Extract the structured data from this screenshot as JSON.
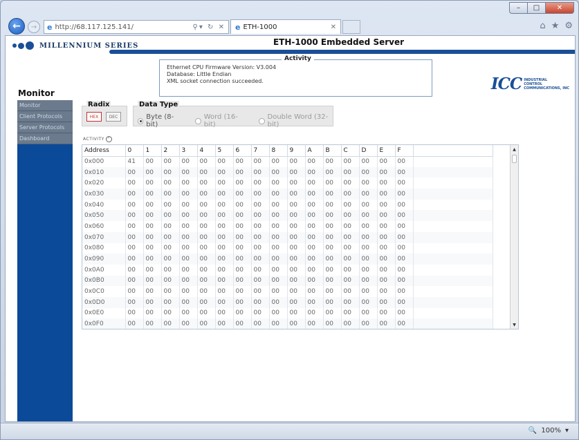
{
  "browser": {
    "url": "http://68.117.125.141/",
    "tab_title": "ETH-1000",
    "zoom": "100%"
  },
  "header": {
    "logo_text": "MILLENNIUM SERIES",
    "server_title": "ETH-1000 Embedded Server",
    "activity_title": "Activity",
    "activity_lines": [
      "Ethernet CPU Firmware Version: V3.004",
      "Database: Little Endian",
      "XML socket connection succeeded."
    ],
    "icc_mark": "ICC",
    "icc_text": [
      "INDUSTRIAL",
      "CONTROL",
      "COMMUNICATIONS, INC"
    ],
    "page_title": "Monitor"
  },
  "sidebar": {
    "items": [
      {
        "label": "Monitor"
      },
      {
        "label": "Client Protocols"
      },
      {
        "label": "Server Protocols"
      },
      {
        "label": "Dashboard"
      }
    ]
  },
  "controls": {
    "radix_title": "Radix",
    "radix_hex": "HEX",
    "radix_dec": "DEC",
    "data_type_title": "Data Type",
    "options": [
      "Byte (8-bit)",
      "Word (16-bit)",
      "Double Word (32-bit)"
    ],
    "activity_label": "ACTIVITY"
  },
  "table": {
    "headers": [
      "Address",
      "0",
      "1",
      "2",
      "3",
      "4",
      "5",
      "6",
      "7",
      "8",
      "9",
      "A",
      "B",
      "C",
      "D",
      "E",
      "F",
      ""
    ],
    "rows": [
      {
        "addr": "0x000",
        "values": [
          "41",
          "00",
          "00",
          "00",
          "00",
          "00",
          "00",
          "00",
          "00",
          "00",
          "00",
          "00",
          "00",
          "00",
          "00",
          "00"
        ]
      },
      {
        "addr": "0x010",
        "values": [
          "00",
          "00",
          "00",
          "00",
          "00",
          "00",
          "00",
          "00",
          "00",
          "00",
          "00",
          "00",
          "00",
          "00",
          "00",
          "00"
        ]
      },
      {
        "addr": "0x020",
        "values": [
          "00",
          "00",
          "00",
          "00",
          "00",
          "00",
          "00",
          "00",
          "00",
          "00",
          "00",
          "00",
          "00",
          "00",
          "00",
          "00"
        ]
      },
      {
        "addr": "0x030",
        "values": [
          "00",
          "00",
          "00",
          "00",
          "00",
          "00",
          "00",
          "00",
          "00",
          "00",
          "00",
          "00",
          "00",
          "00",
          "00",
          "00"
        ]
      },
      {
        "addr": "0x040",
        "values": [
          "00",
          "00",
          "00",
          "00",
          "00",
          "00",
          "00",
          "00",
          "00",
          "00",
          "00",
          "00",
          "00",
          "00",
          "00",
          "00"
        ]
      },
      {
        "addr": "0x050",
        "values": [
          "00",
          "00",
          "00",
          "00",
          "00",
          "00",
          "00",
          "00",
          "00",
          "00",
          "00",
          "00",
          "00",
          "00",
          "00",
          "00"
        ]
      },
      {
        "addr": "0x060",
        "values": [
          "00",
          "00",
          "00",
          "00",
          "00",
          "00",
          "00",
          "00",
          "00",
          "00",
          "00",
          "00",
          "00",
          "00",
          "00",
          "00"
        ]
      },
      {
        "addr": "0x070",
        "values": [
          "00",
          "00",
          "00",
          "00",
          "00",
          "00",
          "00",
          "00",
          "00",
          "00",
          "00",
          "00",
          "00",
          "00",
          "00",
          "00"
        ]
      },
      {
        "addr": "0x080",
        "values": [
          "00",
          "00",
          "00",
          "00",
          "00",
          "00",
          "00",
          "00",
          "00",
          "00",
          "00",
          "00",
          "00",
          "00",
          "00",
          "00"
        ]
      },
      {
        "addr": "0x090",
        "values": [
          "00",
          "00",
          "00",
          "00",
          "00",
          "00",
          "00",
          "00",
          "00",
          "00",
          "00",
          "00",
          "00",
          "00",
          "00",
          "00"
        ]
      },
      {
        "addr": "0x0A0",
        "values": [
          "00",
          "00",
          "00",
          "00",
          "00",
          "00",
          "00",
          "00",
          "00",
          "00",
          "00",
          "00",
          "00",
          "00",
          "00",
          "00"
        ]
      },
      {
        "addr": "0x0B0",
        "values": [
          "00",
          "00",
          "00",
          "00",
          "00",
          "00",
          "00",
          "00",
          "00",
          "00",
          "00",
          "00",
          "00",
          "00",
          "00",
          "00"
        ]
      },
      {
        "addr": "0x0C0",
        "values": [
          "00",
          "00",
          "00",
          "00",
          "00",
          "00",
          "00",
          "00",
          "00",
          "00",
          "00",
          "00",
          "00",
          "00",
          "00",
          "00"
        ]
      },
      {
        "addr": "0x0D0",
        "values": [
          "00",
          "00",
          "00",
          "00",
          "00",
          "00",
          "00",
          "00",
          "00",
          "00",
          "00",
          "00",
          "00",
          "00",
          "00",
          "00"
        ]
      },
      {
        "addr": "0x0E0",
        "values": [
          "00",
          "00",
          "00",
          "00",
          "00",
          "00",
          "00",
          "00",
          "00",
          "00",
          "00",
          "00",
          "00",
          "00",
          "00",
          "00"
        ]
      },
      {
        "addr": "0x0F0",
        "values": [
          "00",
          "00",
          "00",
          "00",
          "00",
          "00",
          "00",
          "00",
          "00",
          "00",
          "00",
          "00",
          "00",
          "00",
          "00",
          "00"
        ]
      }
    ]
  },
  "colors": {
    "sidebar_bg": "#0b4a99",
    "brand_blue": "#1a4f97",
    "radix_active": "#c03030"
  }
}
